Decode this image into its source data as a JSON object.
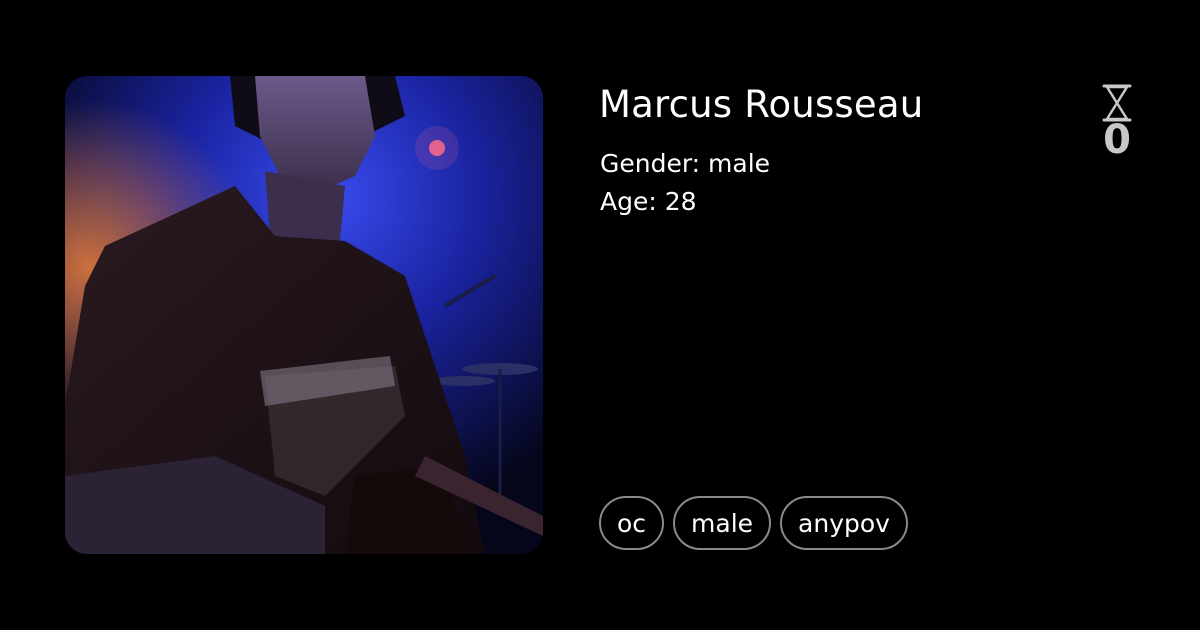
{
  "character": {
    "name": "Marcus Rousseau",
    "gender_line": "Gender: male",
    "age_line": "Age: 28"
  },
  "counter": {
    "icon": "hourglass-icon",
    "value": "0"
  },
  "tags": [
    "oc",
    "male",
    "anypov"
  ],
  "portrait": {
    "icon": "character-portrait",
    "colors": {
      "background": "#0b0c2a",
      "stage_light": "#2b3bd6",
      "warm_glow": "#d0642a",
      "shirt": "#1c1214"
    }
  }
}
